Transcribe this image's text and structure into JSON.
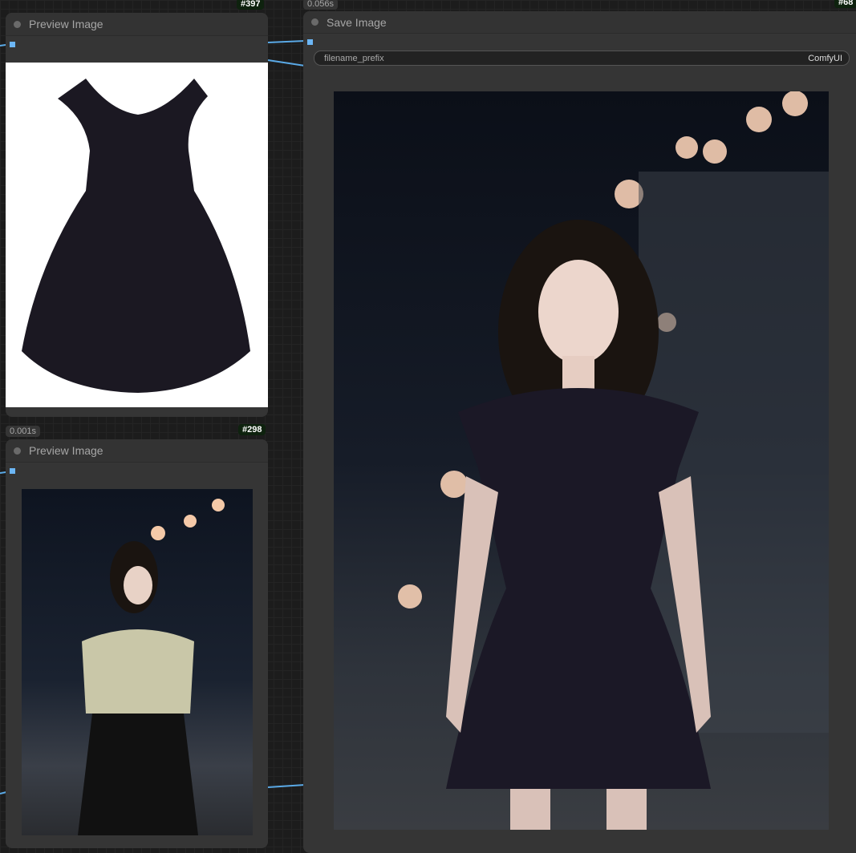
{
  "nodes": [
    {
      "id": "#397",
      "title": "Preview Image",
      "image": "black lolita dress product photo"
    },
    {
      "id": "#298",
      "time": "0.001s",
      "title": "Preview Image",
      "image": "woman in blouse and black skirt on night street"
    },
    {
      "id": "#68",
      "time": "0.056s",
      "title": "Save Image",
      "image": "woman in black dress on night street",
      "widget": {
        "label": "filename_prefix",
        "value": "ComfyUI"
      }
    }
  ],
  "colors": {
    "link": "#5aa9e6",
    "canvas": "#1c1c1c",
    "node": "#353535"
  }
}
